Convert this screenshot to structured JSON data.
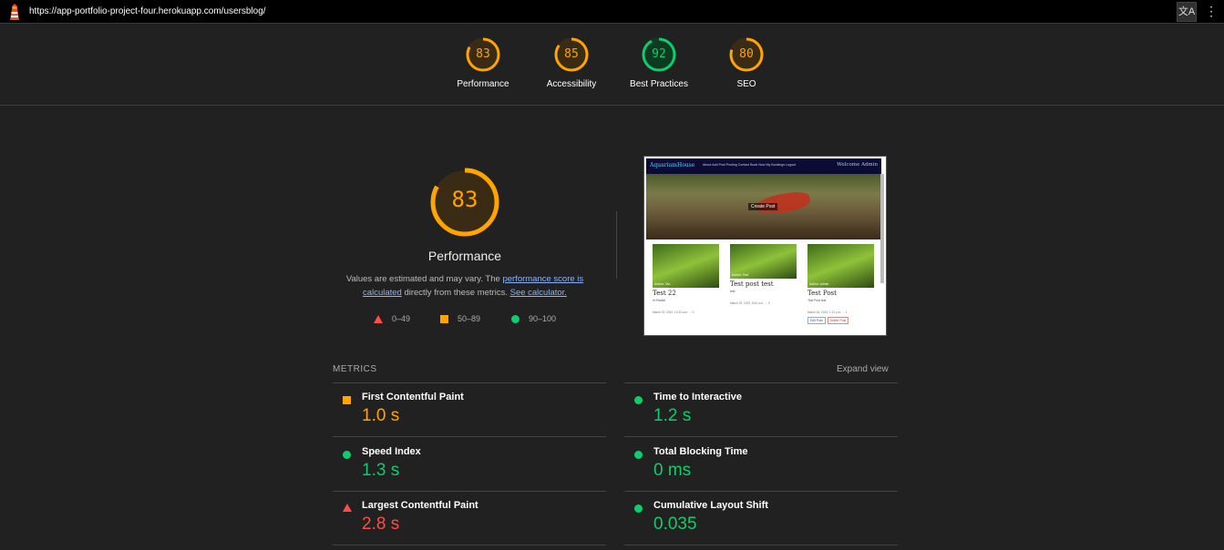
{
  "browser": {
    "url": "https://app-portfolio-project-four.herokuapp.com/usersblog/",
    "translate_icon": "translate-icon",
    "more_icon": "more-vert-icon"
  },
  "colors": {
    "pass": "#0cce6b",
    "average": "#ffa400",
    "fail": "#ff4e42",
    "background": "#212121"
  },
  "gauges": [
    {
      "label": "Performance",
      "score": "83",
      "color": "#ffa400"
    },
    {
      "label": "Accessibility",
      "score": "85",
      "color": "#ffa400"
    },
    {
      "label": "Best Practices",
      "score": "92",
      "color": "#0cce6b"
    },
    {
      "label": "SEO",
      "score": "80",
      "color": "#ffa400"
    }
  ],
  "performance": {
    "score": "83",
    "title": "Performance",
    "desc_prefix": "Values are estimated and may vary. The ",
    "desc_link1": "performance score is calculated",
    "desc_mid": " directly from these metrics. ",
    "desc_link2": "See calculator."
  },
  "legend": {
    "fail": "0–49",
    "average": "50–89",
    "pass": "90–100"
  },
  "screenshot": {
    "brand": "AquariumHouse",
    "nav_links": "About   Add Post   Posting   Contact   Book Now   My Bookings   Logout",
    "welcome": "Welcome Admin",
    "hero_button": "Create Post",
    "cards": [
      {
        "author": "Author: Oto",
        "title": "Test 22",
        "subtitle": "Hi Reddit",
        "date": "March 22, 2022, 12:23 a.m. ♡ 0"
      },
      {
        "author": "Author: Test",
        "title": "Test post test",
        "subtitle": "test",
        "date": "March 20, 2022, 8:42 a.m. ♡ 0"
      },
      {
        "author": "Author: Admin",
        "title": "Test Post",
        "subtitle": "Test Post test",
        "date": "March 16, 2022, 1:21 p.m. ♡ 1",
        "edit": "Edit Post",
        "delete": "Delete Post"
      }
    ]
  },
  "metrics": {
    "header": "METRICS",
    "expand": "Expand view",
    "items": [
      {
        "name": "First Contentful Paint",
        "value": "1.0 s",
        "rating": "average"
      },
      {
        "name": "Time to Interactive",
        "value": "1.2 s",
        "rating": "pass"
      },
      {
        "name": "Speed Index",
        "value": "1.3 s",
        "rating": "pass"
      },
      {
        "name": "Total Blocking Time",
        "value": "0 ms",
        "rating": "pass"
      },
      {
        "name": "Largest Contentful Paint",
        "value": "2.8 s",
        "rating": "fail"
      },
      {
        "name": "Cumulative Layout Shift",
        "value": "0.035",
        "rating": "pass"
      }
    ]
  }
}
